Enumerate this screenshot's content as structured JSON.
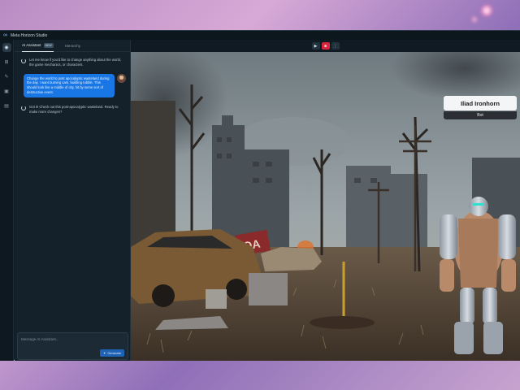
{
  "app": {
    "title": "Meta Horizon Studio",
    "logo_glyph": "∞"
  },
  "rail": {
    "items": [
      {
        "name": "assistant-rail-icon",
        "glyph": "◉",
        "active": true
      },
      {
        "name": "layers-rail-icon",
        "glyph": "⊞",
        "active": false
      },
      {
        "name": "script-rail-icon",
        "glyph": "✎",
        "active": false
      },
      {
        "name": "assets-rail-icon",
        "glyph": "▣",
        "active": false
      },
      {
        "name": "gallery-rail-icon",
        "glyph": "▤",
        "active": false
      }
    ]
  },
  "panel": {
    "tabs": {
      "assistant": "AI Assistant",
      "assistant_badge": "NEW",
      "hierarchy": "Hierarchy"
    },
    "messages": {
      "ai_1": "Let me know if you'd like to change anything about the world, the game mechanics, or characters.",
      "user_1": "Change the world to post apocalyptic wasteland during the day. I want burning cars, building rubble. This should look like a middle of city, hit by some sort of destructive event.",
      "ai_2": "Got it! Check out this post-apocalyptic wasteland. Ready to make more changes?"
    },
    "composer": {
      "placeholder": "Message AI Assistant...",
      "generate_label": "Generate",
      "generate_icon": "✦"
    }
  },
  "viewport": {
    "controls": {
      "play": "▶",
      "stop": "■",
      "more": "⋮"
    },
    "npc": {
      "name": "Iliad Ironhorn",
      "role": "Bot"
    },
    "burning_sign": "OA"
  },
  "colors": {
    "accent": "#1877e5",
    "stop": "#d7263d"
  }
}
